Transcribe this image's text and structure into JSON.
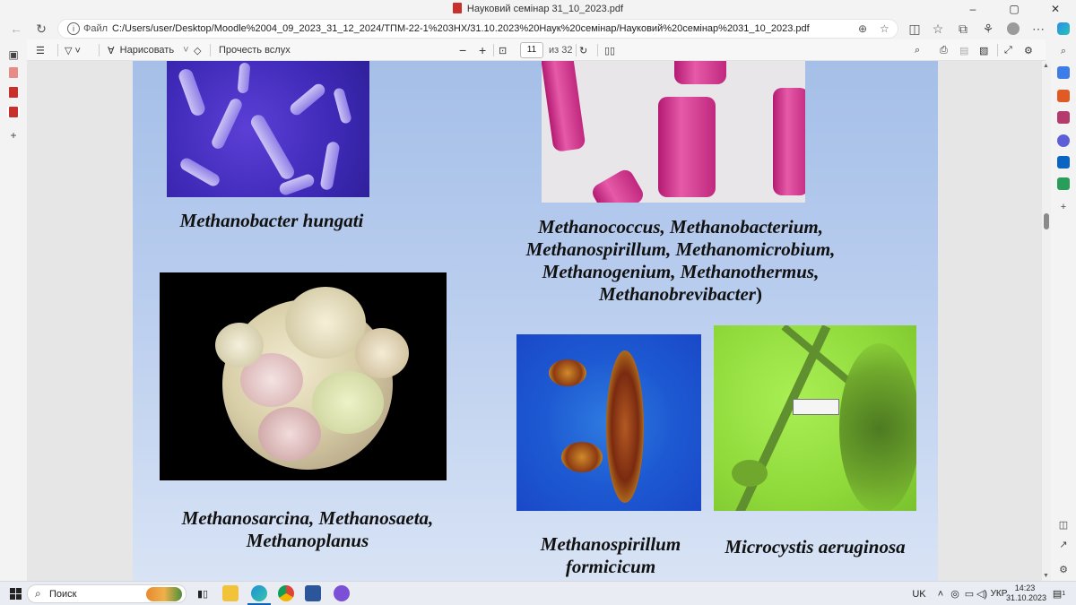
{
  "window": {
    "title": "Науковий семінар 31_10_2023.pdf",
    "controls": {
      "minimize": "–",
      "maximize": "▢",
      "close": "✕"
    }
  },
  "address_bar": {
    "protocol_label": "Файл",
    "url": "C:/Users/user/Desktop/Moodle%2004_09_2023_31_12_2024/ТПМ-22-1%203НХ/31.10.2023%20Наук%20семінар/Науковий%20семінар%2031_10_2023.pdf"
  },
  "pdf_toolbar": {
    "draw_label": "Нарисовать",
    "read_aloud_label": "Прочесть вслух",
    "page_current": "11",
    "page_total_label": "из 32",
    "zoom_out": "−",
    "zoom_in": "+"
  },
  "slide": {
    "captions": {
      "methanobacter": "Methanobacter hungati",
      "group_line1": "Methanococcus, Methanobacterium,",
      "group_line2": "Methanospirillum, Methanomicrobium,",
      "group_line3": "Methanogenium, Methanothermus,",
      "group_line4": "Methanobrevibacter",
      "group_close": ")",
      "sarcina_line1": "Methanosarcina, Methanosaeta,",
      "sarcina_line2": "Methanoplanus",
      "spirillum_line1": "Methanospirillum",
      "spirillum_line2": "formicicum",
      "microcystis": "Microcystis aeruginosa"
    }
  },
  "taskbar": {
    "search_placeholder": "Поиск",
    "language": "UK",
    "ime_label": "УКР",
    "time": "14:23",
    "date": "31.10.2023",
    "notification_count": "1"
  },
  "colors": {
    "slide_top": "#a5bfe8",
    "slide_bottom": "#d8e3f5",
    "pdf_red": "#c8302c",
    "edge_blue": "#0a64c2"
  }
}
